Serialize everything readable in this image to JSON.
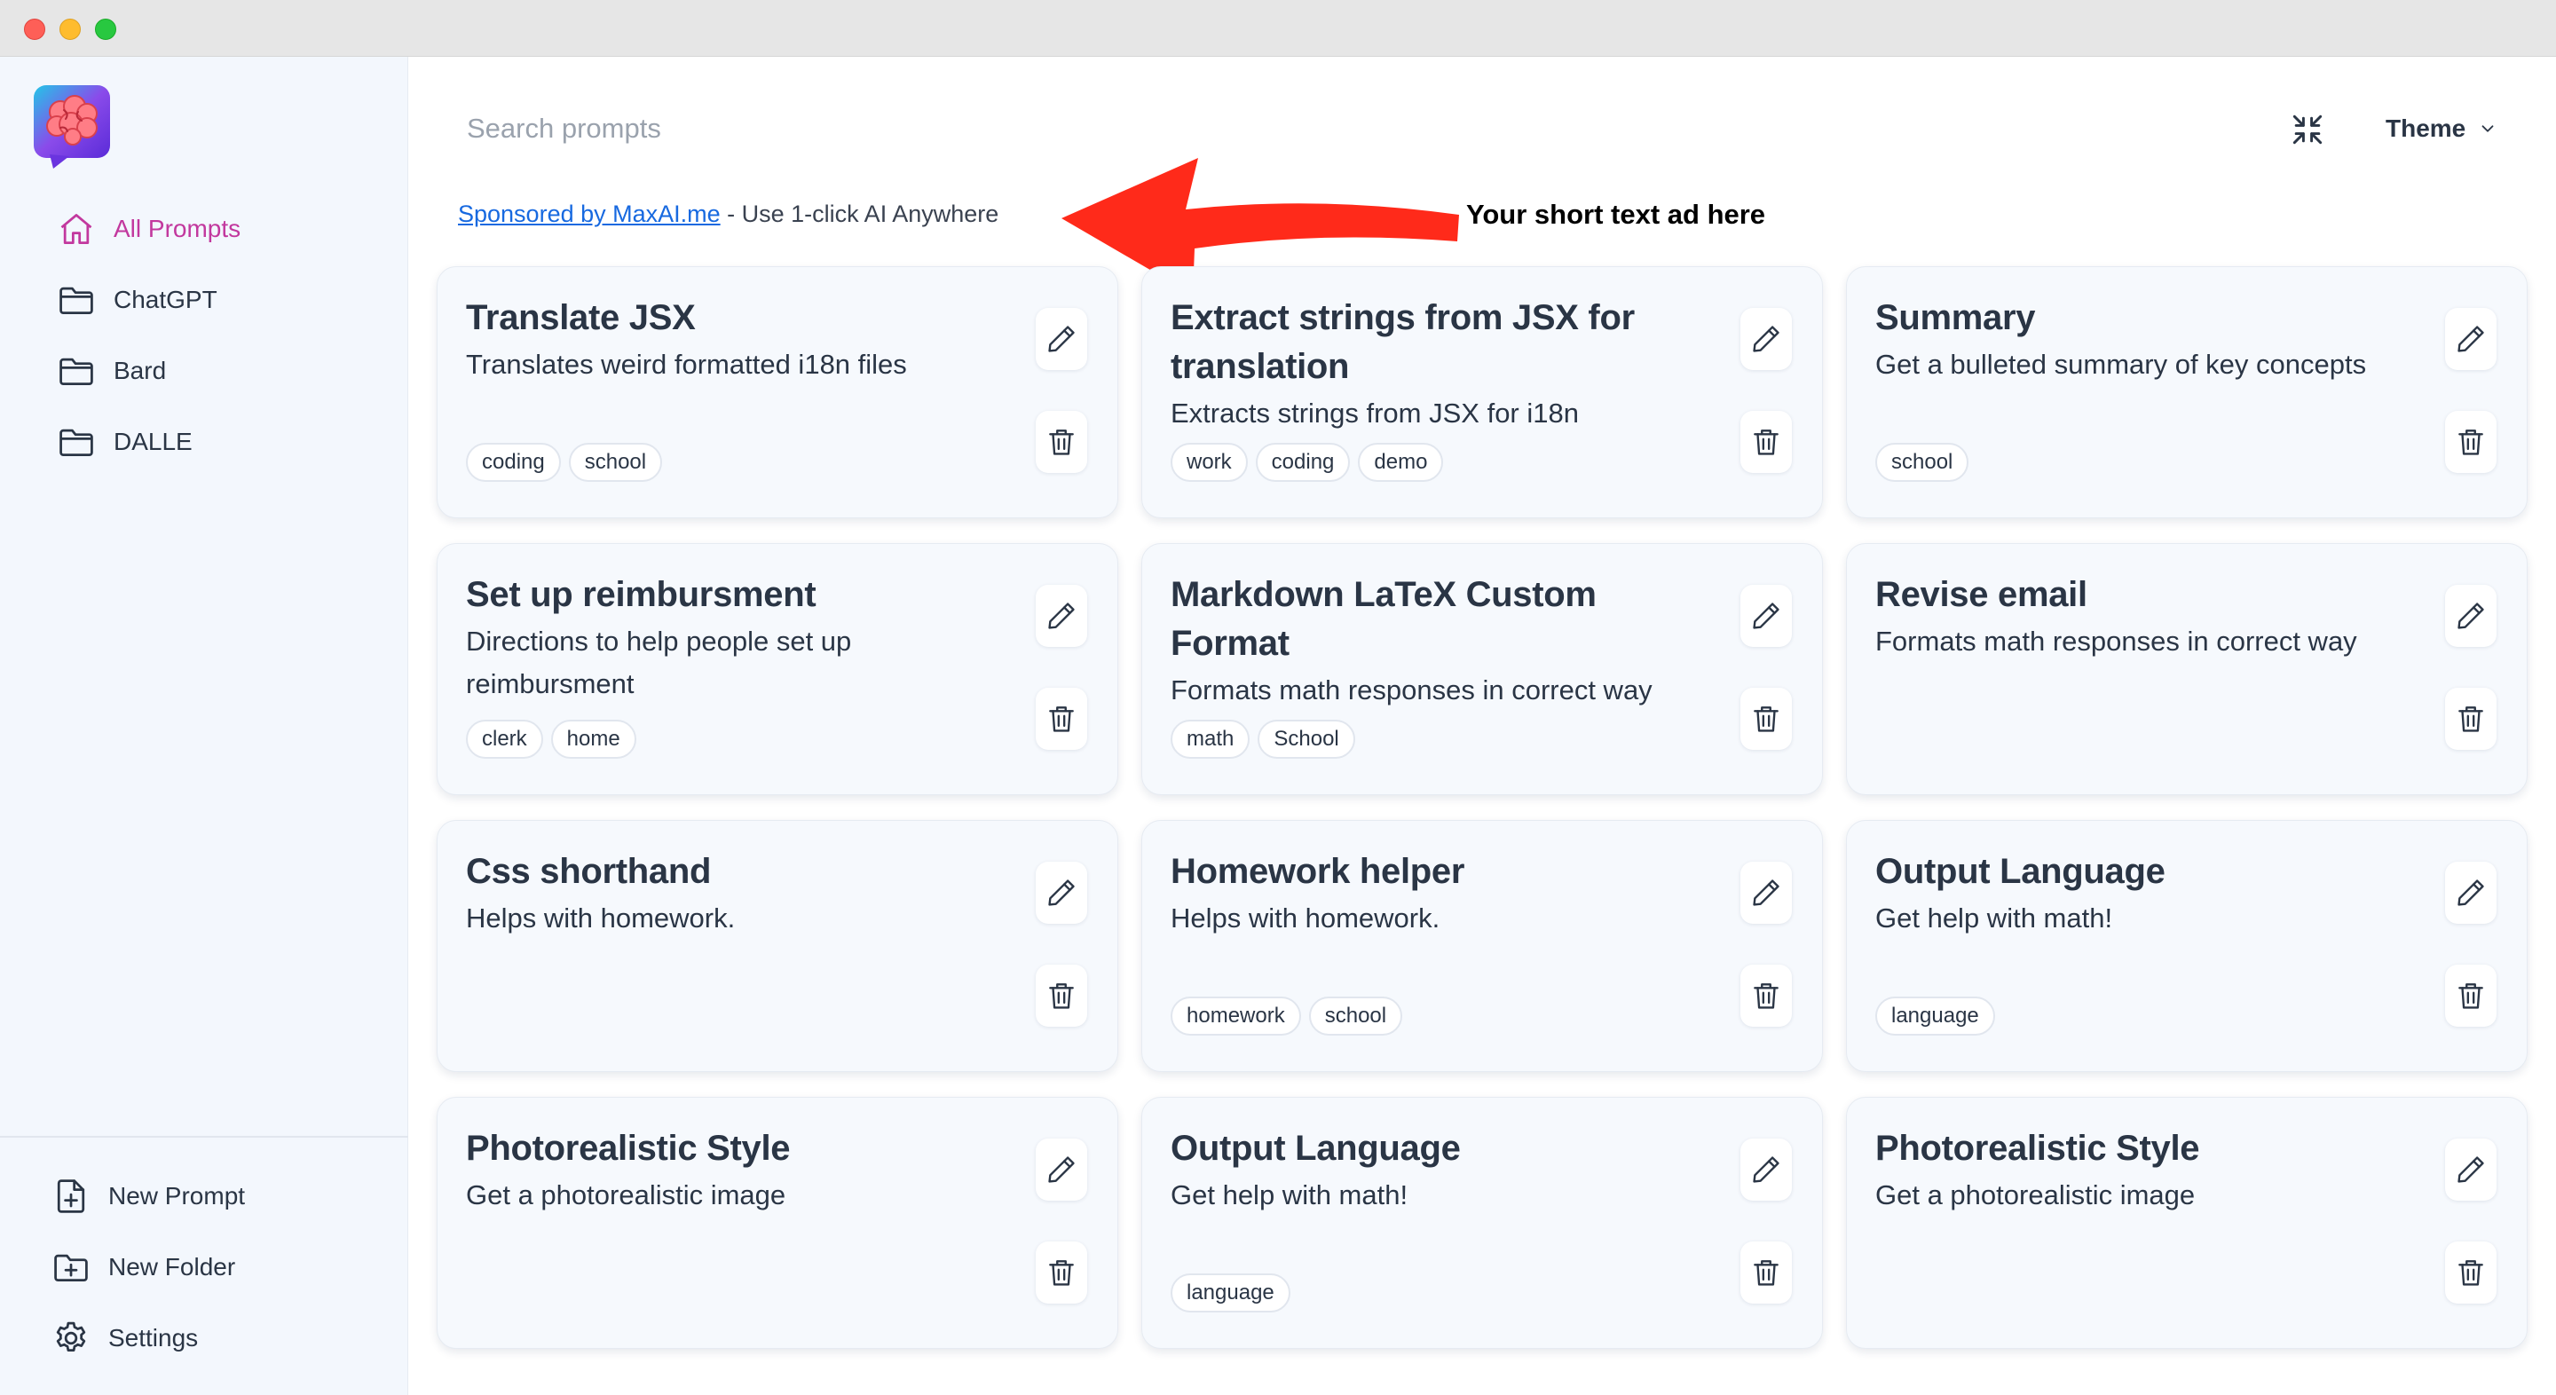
{
  "sidebar": {
    "nav": [
      {
        "label": "All Prompts",
        "icon": "home-icon",
        "active": true
      },
      {
        "label": "ChatGPT",
        "icon": "folder-icon"
      },
      {
        "label": "Bard",
        "icon": "folder-icon"
      },
      {
        "label": "DALLE",
        "icon": "folder-icon"
      }
    ],
    "bottom": [
      {
        "label": "New Prompt",
        "icon": "file-plus-icon"
      },
      {
        "label": "New Folder",
        "icon": "folder-plus-icon"
      },
      {
        "label": "Settings",
        "icon": "gear-icon"
      }
    ]
  },
  "header": {
    "search_placeholder": "Search prompts",
    "theme_label": "Theme"
  },
  "ad": {
    "link_text": "Sponsored by MaxAI.me",
    "text": " - Use 1-click AI Anywhere",
    "annotation": "Your short text ad here"
  },
  "colors": {
    "accent": "#c2389e",
    "link": "#1769e0",
    "arrow": "#ff2a1a",
    "sidebar_bg": "#f3f7fd",
    "card_bg": "#f6f9fd"
  },
  "cards": [
    {
      "title": "Translate JSX",
      "description": "Translates weird formatted i18n files",
      "tags": [
        "coding",
        "school"
      ]
    },
    {
      "title": "Extract strings from JSX for translation",
      "description": "Extracts strings from JSX for i18n",
      "tags": [
        "work",
        "coding",
        "demo"
      ]
    },
    {
      "title": "Summary",
      "description": "Get a bulleted summary of key concepts",
      "tags": [
        "school"
      ]
    },
    {
      "title": "Set up reimbursment",
      "description": "Directions to help people set up reimbursment",
      "tags": [
        "clerk",
        "home"
      ]
    },
    {
      "title": "Markdown LaTeX Custom Format",
      "description": "Formats math responses in correct way",
      "tags": [
        "math",
        "School"
      ]
    },
    {
      "title": "Revise email",
      "description": "Formats math responses in correct way",
      "tags": []
    },
    {
      "title": "Css shorthand",
      "description": "Helps with homework.",
      "tags": []
    },
    {
      "title": "Homework helper",
      "description": "Helps with homework.",
      "tags": [
        "homework",
        "school"
      ]
    },
    {
      "title": "Output Language",
      "description": "Get help with math!",
      "tags": [
        "language"
      ]
    },
    {
      "title": "Photorealistic Style",
      "description": "Get a photorealistic image",
      "tags": []
    },
    {
      "title": "Output Language",
      "description": "Get help with math!",
      "tags": [
        "language"
      ]
    },
    {
      "title": "Photorealistic Style",
      "description": "Get a photorealistic image",
      "tags": []
    }
  ]
}
